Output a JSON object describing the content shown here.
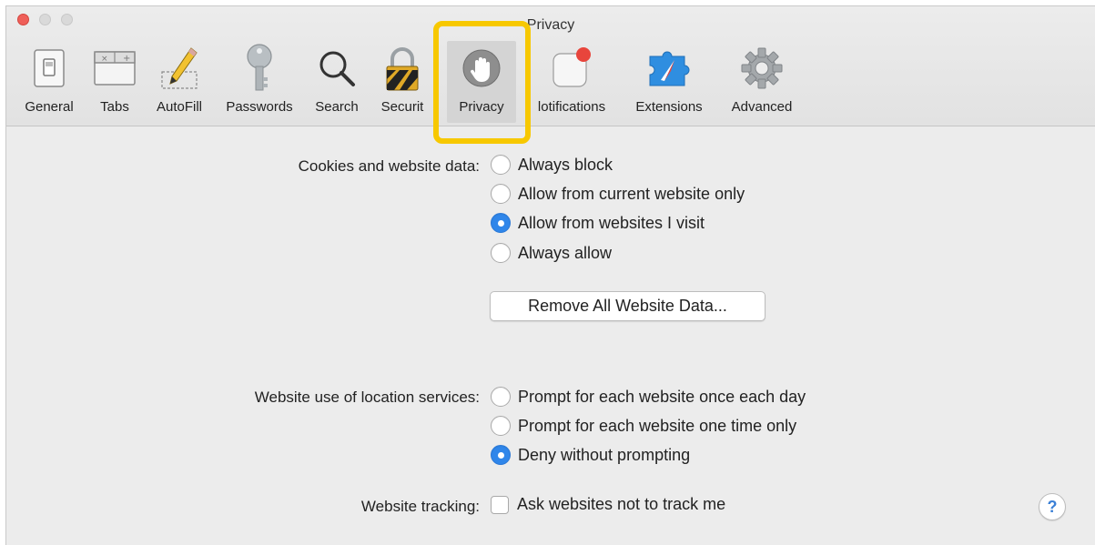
{
  "window": {
    "title": "Privacy"
  },
  "toolbar": {
    "items": [
      {
        "label": "General",
        "icon": "switch-icon"
      },
      {
        "label": "Tabs",
        "icon": "tabs-icon"
      },
      {
        "label": "AutoFill",
        "icon": "pencil-icon"
      },
      {
        "label": "Passwords",
        "icon": "key-icon"
      },
      {
        "label": "Search",
        "icon": "magnifier-icon"
      },
      {
        "label": "Securit",
        "icon": "lock-icon"
      },
      {
        "label": "Privacy",
        "icon": "hand-icon"
      },
      {
        "label": "lotifications",
        "icon": "notification-icon"
      },
      {
        "label": "Extensions",
        "icon": "puzzle-icon"
      },
      {
        "label": "Advanced",
        "icon": "gear-icon"
      }
    ],
    "selected": "Privacy"
  },
  "cookies": {
    "label": "Cookies and website data:",
    "options": [
      "Always block",
      "Allow from current website only",
      "Allow from websites I visit",
      "Always allow"
    ],
    "selected_index": 2,
    "remove_button": "Remove All Website Data..."
  },
  "location": {
    "label": "Website use of location services:",
    "options": [
      "Prompt for each website once each day",
      "Prompt for each website one time only",
      "Deny without prompting"
    ],
    "selected_index": 2
  },
  "tracking": {
    "label": "Website tracking:",
    "checkbox_label": "Ask websites not to track me",
    "checked": false
  },
  "help": {
    "label": "?"
  },
  "colors": {
    "accent": "#2f86ea",
    "highlight": "#f7c800",
    "close_button": "#ef5f59",
    "notification_badge": "#e8453c"
  }
}
